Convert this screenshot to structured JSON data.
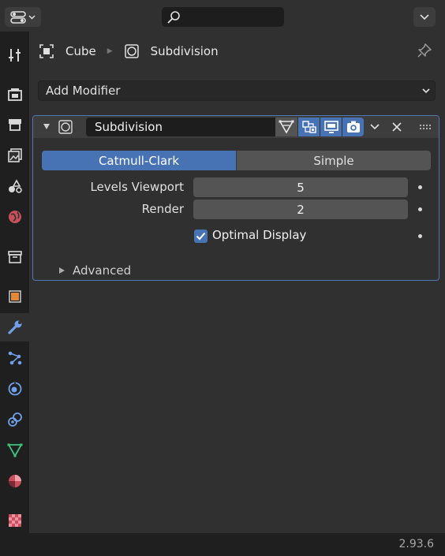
{
  "header": {
    "search_placeholder": ""
  },
  "breadcrumb": {
    "object_name": "Cube",
    "modifier_name": "Subdivision"
  },
  "add_modifier": {
    "label": "Add Modifier"
  },
  "modifier": {
    "name": "Subdivision",
    "algorithm_options": [
      "Catmull-Clark",
      "Simple"
    ],
    "selected_algorithm": "Catmull-Clark",
    "levels_viewport_label": "Levels Viewport",
    "levels_viewport_value": "5",
    "render_label": "Render",
    "render_value": "2",
    "optimal_display_label": "Optimal Display",
    "optimal_display_checked": true,
    "advanced_label": "Advanced"
  },
  "status": {
    "version": "2.93.6"
  },
  "colors": {
    "accent": "#4772b3",
    "panel_border": "#5176b3",
    "background": "#303030",
    "tab_strip": "#1f1f1f"
  },
  "icons": {
    "tabs": [
      "tool-icon",
      "render-icon",
      "output-icon",
      "view-layer-icon",
      "scene-icon",
      "world-icon",
      "collection-icon",
      "object-icon",
      "modifier-wrench-icon",
      "particles-icon",
      "physics-icon",
      "constraints-icon",
      "object-data-icon",
      "material-icon",
      "texture-icon"
    ]
  }
}
